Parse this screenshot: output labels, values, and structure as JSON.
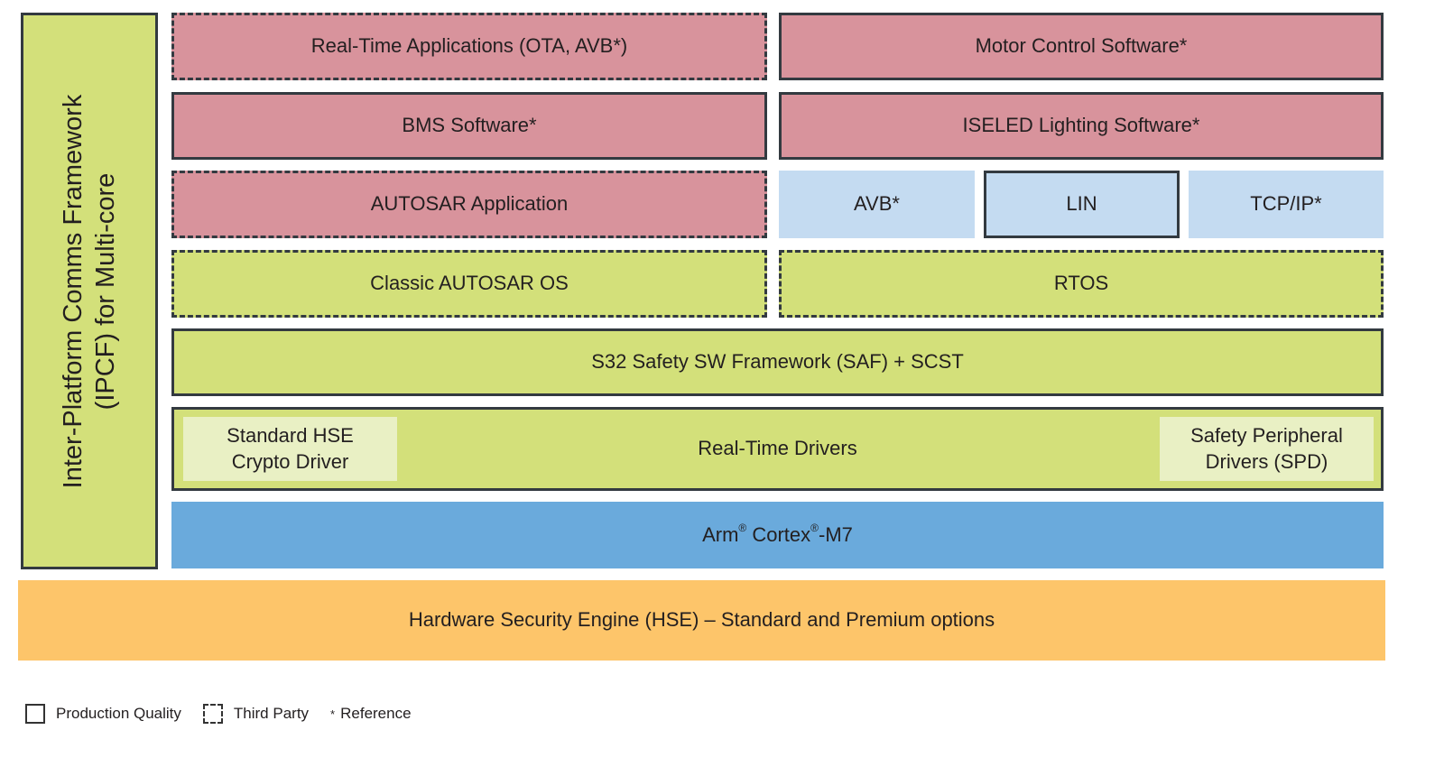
{
  "diagram": {
    "ipcf_label_line1": "Inter-Platform Comms Framework",
    "ipcf_label_line2": "(IPCF) for Multi-core",
    "rows": {
      "real_time_apps": "Real-Time Applications (OTA, AVB*)",
      "motor_control": "Motor Control Software*",
      "bms": "BMS Software*",
      "iseled": "ISELED Lighting Software*",
      "autosar_app": "AUTOSAR Application",
      "avb": "AVB*",
      "lin": "LIN",
      "tcpip": "TCP/IP*",
      "classic_autosar_os": "Classic AUTOSAR OS",
      "rtos": "RTOS",
      "saf": "S32 Safety SW Framework (SAF) + SCST",
      "rtd": "Real-Time Drivers",
      "hse_crypto_line1": "Standard HSE",
      "hse_crypto_line2": "Crypto Driver",
      "spd_line1": "Safety Peripheral",
      "spd_line2": "Drivers (SPD)",
      "arm_part1": "Arm",
      "arm_reg1": "®",
      "arm_part2": " Cortex",
      "arm_reg2": "®",
      "arm_part3": "-M7",
      "hse": "Hardware Security Engine (HSE) – Standard and Premium options"
    },
    "colors": {
      "application": "#d8939c",
      "os_framework": "#d3e07a",
      "comms": "#c4dbf1",
      "core": "#6aaadc",
      "hardware": "#fdc56a"
    }
  },
  "legend": {
    "production_quality": "Production Quality",
    "third_party": "Third Party",
    "reference_marker": "*",
    "reference": "Reference"
  }
}
